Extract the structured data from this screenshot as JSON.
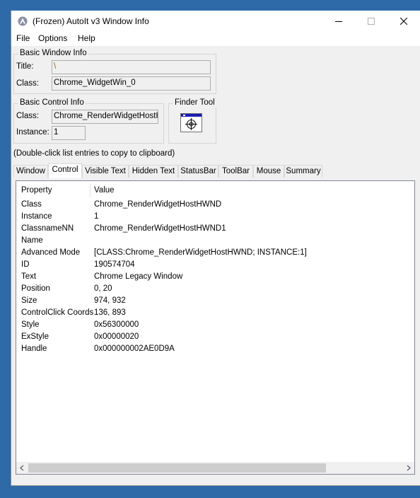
{
  "window": {
    "title": "(Frozen) AutoIt v3 Window Info"
  },
  "menu": [
    "File",
    "Options",
    "Help"
  ],
  "basic_window": {
    "legend": "Basic Window Info",
    "title_label": "Title:",
    "title_value": "\\",
    "class_label": "Class:",
    "class_value": "Chrome_WidgetWin_0"
  },
  "basic_control": {
    "legend": "Basic Control Info",
    "class_label": "Class:",
    "class_value": "Chrome_RenderWidgetHostH\\",
    "instance_label": "Instance:",
    "instance_value": "1"
  },
  "finder": {
    "legend": "Finder Tool"
  },
  "hint": "(Double-click list entries to copy to clipboard)",
  "tabs": [
    "Window",
    "Control",
    "Visible Text",
    "Hidden Text",
    "StatusBar",
    "ToolBar",
    "Mouse",
    "Summary"
  ],
  "active_tab": "Control",
  "list": {
    "columns": [
      "Property",
      "Value"
    ],
    "rows": [
      [
        "Class",
        "Chrome_RenderWidgetHostHWND"
      ],
      [
        "Instance",
        "1"
      ],
      [
        "ClassnameNN",
        "Chrome_RenderWidgetHostHWND1"
      ],
      [
        "Name",
        ""
      ],
      [
        "Advanced Mode",
        "[CLASS:Chrome_RenderWidgetHostHWND; INSTANCE:1]"
      ],
      [
        "ID",
        "190574704"
      ],
      [
        "Text",
        "Chrome Legacy Window"
      ],
      [
        "Position",
        "0, 20"
      ],
      [
        "Size",
        "974, 932"
      ],
      [
        "ControlClick Coords",
        "136, 893"
      ],
      [
        "Style",
        "0x56300000"
      ],
      [
        "ExStyle",
        "0x00000020"
      ],
      [
        "Handle",
        "0x000000002AE0D9A"
      ]
    ]
  },
  "colors": {
    "desktop": "#2f6aa8",
    "window_bg": "#f0f0f0",
    "finder_bar": "#1c1cb4"
  }
}
